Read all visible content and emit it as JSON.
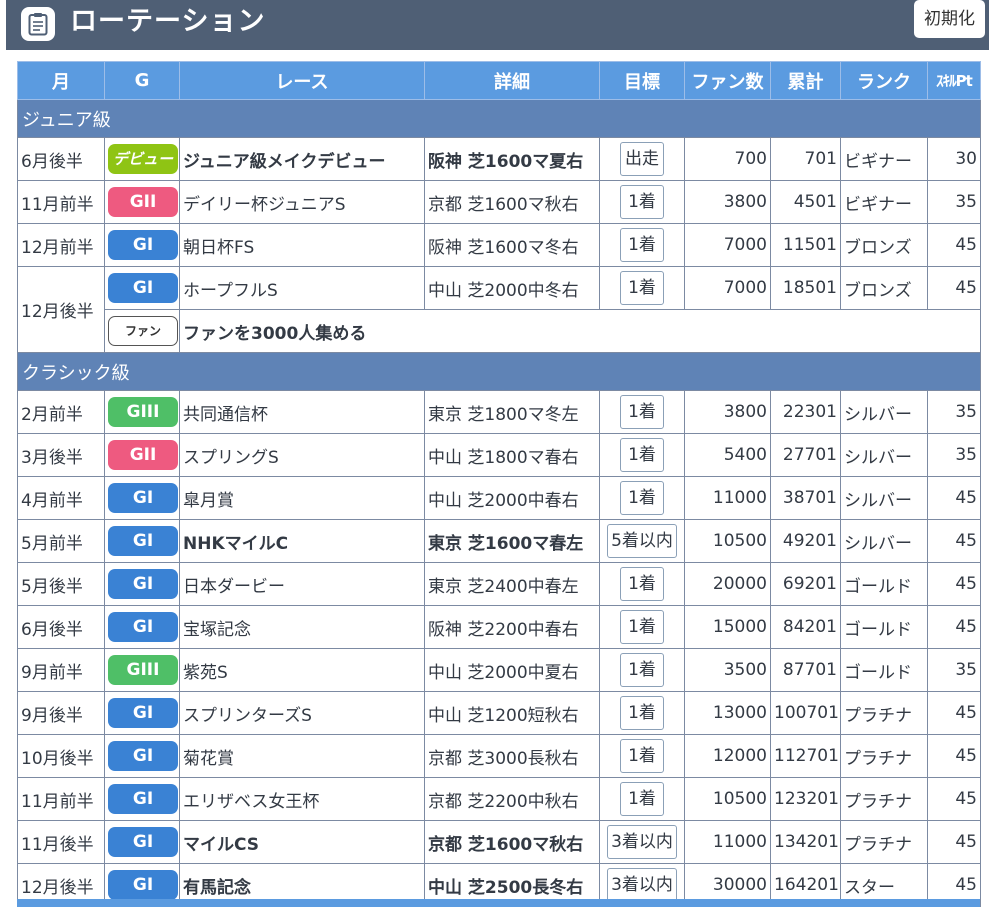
{
  "header": {
    "title": "ローテーション",
    "reset_label": "初期化",
    "icon": "clipboard-icon"
  },
  "columns": [
    "月",
    "G",
    "レース",
    "詳細",
    "目標",
    "ファン数",
    "累計",
    "ランク",
    "ｽｷﾙPt"
  ],
  "colors": {
    "header_bg": "#4f5f75",
    "table_header_bg": "#5b9be0",
    "section_bg": "#5f83b6",
    "g1": "#3a82d4",
    "g2": "#ee5a80",
    "g3": "#4fbf67",
    "debut": "#8fc414"
  },
  "sections": [
    {
      "label": "ジュニア級",
      "rows": [
        {
          "month": "6月後半",
          "grade": "デビュー",
          "grade_class": "debut",
          "race": "ジュニア級メイクデビュー",
          "detail": "阪神 芝1600マ夏右",
          "target": "出走",
          "fans": "700",
          "total": "701",
          "rank": "ビギナー",
          "pt": "30",
          "bold": true
        },
        {
          "month": "11月前半",
          "grade": "GII",
          "grade_class": "g2",
          "race": "デイリー杯ジュニアS",
          "detail": "京都 芝1600マ秋右",
          "target": "1着",
          "fans": "3800",
          "total": "4501",
          "rank": "ビギナー",
          "pt": "35",
          "bold": false
        },
        {
          "month": "12月前半",
          "grade": "GI",
          "grade_class": "g1",
          "race": "朝日杯FS",
          "detail": "阪神 芝1600マ冬右",
          "target": "1着",
          "fans": "7000",
          "total": "11501",
          "rank": "ブロンズ",
          "pt": "45",
          "bold": false
        },
        {
          "month": "12月後半",
          "grade": "GI",
          "grade_class": "g1",
          "race": "ホープフルS",
          "detail": "中山 芝2000中冬右",
          "target": "1着",
          "fans": "7000",
          "total": "18501",
          "rank": "ブロンズ",
          "pt": "45",
          "bold": false,
          "fan_goal": {
            "badge": "ファン",
            "text": "ファンを3000人集める"
          }
        }
      ]
    },
    {
      "label": "クラシック級",
      "rows": [
        {
          "month": "2月前半",
          "grade": "GIII",
          "grade_class": "g3",
          "race": "共同通信杯",
          "detail": "東京 芝1800マ冬左",
          "target": "1着",
          "fans": "3800",
          "total": "22301",
          "rank": "シルバー",
          "pt": "35",
          "bold": false
        },
        {
          "month": "3月後半",
          "grade": "GII",
          "grade_class": "g2",
          "race": "スプリングS",
          "detail": "中山 芝1800マ春右",
          "target": "1着",
          "fans": "5400",
          "total": "27701",
          "rank": "シルバー",
          "pt": "35",
          "bold": false
        },
        {
          "month": "4月前半",
          "grade": "GI",
          "grade_class": "g1",
          "race": "皐月賞",
          "detail": "中山 芝2000中春右",
          "target": "1着",
          "fans": "11000",
          "total": "38701",
          "rank": "シルバー",
          "pt": "45",
          "bold": false
        },
        {
          "month": "5月前半",
          "grade": "GI",
          "grade_class": "g1",
          "race": "NHKマイルC",
          "detail": "東京 芝1600マ春左",
          "target": "5着以内",
          "fans": "10500",
          "total": "49201",
          "rank": "シルバー",
          "pt": "45",
          "bold": true
        },
        {
          "month": "5月後半",
          "grade": "GI",
          "grade_class": "g1",
          "race": "日本ダービー",
          "detail": "東京 芝2400中春左",
          "target": "1着",
          "fans": "20000",
          "total": "69201",
          "rank": "ゴールド",
          "pt": "45",
          "bold": false
        },
        {
          "month": "6月後半",
          "grade": "GI",
          "grade_class": "g1",
          "race": "宝塚記念",
          "detail": "阪神 芝2200中春右",
          "target": "1着",
          "fans": "15000",
          "total": "84201",
          "rank": "ゴールド",
          "pt": "45",
          "bold": false
        },
        {
          "month": "9月前半",
          "grade": "GIII",
          "grade_class": "g3",
          "race": "紫苑S",
          "detail": "中山 芝2000中夏右",
          "target": "1着",
          "fans": "3500",
          "total": "87701",
          "rank": "ゴールド",
          "pt": "35",
          "bold": false
        },
        {
          "month": "9月後半",
          "grade": "GI",
          "grade_class": "g1",
          "race": "スプリンターズS",
          "detail": "中山 芝1200短秋右",
          "target": "1着",
          "fans": "13000",
          "total": "100701",
          "rank": "プラチナ",
          "pt": "45",
          "bold": false
        },
        {
          "month": "10月後半",
          "grade": "GI",
          "grade_class": "g1",
          "race": "菊花賞",
          "detail": "京都 芝3000長秋右",
          "target": "1着",
          "fans": "12000",
          "total": "112701",
          "rank": "プラチナ",
          "pt": "45",
          "bold": false
        },
        {
          "month": "11月前半",
          "grade": "GI",
          "grade_class": "g1",
          "race": "エリザベス女王杯",
          "detail": "京都 芝2200中秋右",
          "target": "1着",
          "fans": "10500",
          "total": "123201",
          "rank": "プラチナ",
          "pt": "45",
          "bold": false
        },
        {
          "month": "11月後半",
          "grade": "GI",
          "grade_class": "g1",
          "race": "マイルCS",
          "detail": "京都 芝1600マ秋右",
          "target": "3着以内",
          "fans": "11000",
          "total": "134201",
          "rank": "プラチナ",
          "pt": "45",
          "bold": true
        },
        {
          "month": "12月後半",
          "grade": "GI",
          "grade_class": "g1",
          "race": "有馬記念",
          "detail": "中山 芝2500長冬右",
          "target": "3着以内",
          "fans": "30000",
          "total": "164201",
          "rank": "スター",
          "pt": "45",
          "bold": true
        }
      ]
    }
  ]
}
